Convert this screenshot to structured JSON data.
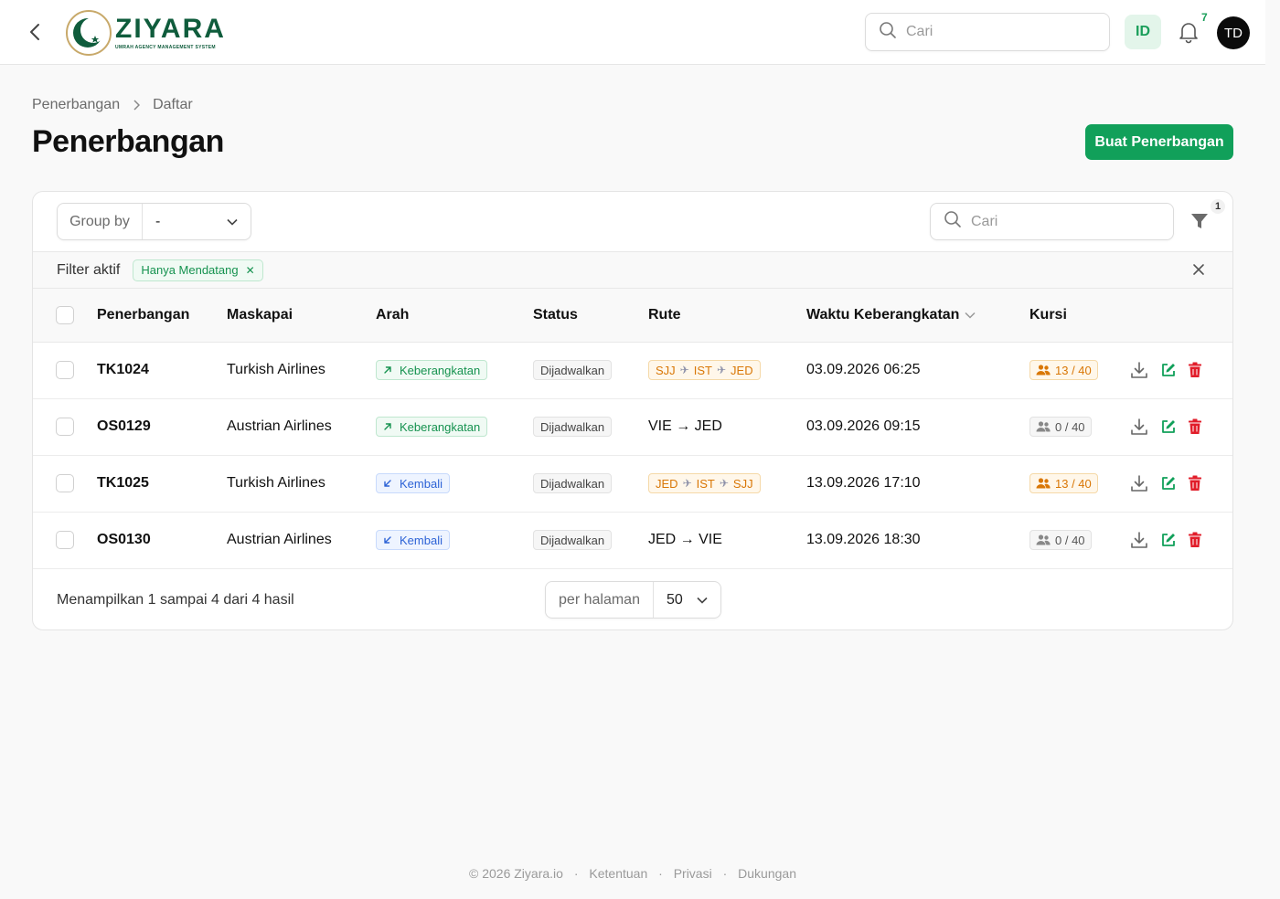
{
  "topbar": {
    "logo_name": "ZIYARA",
    "logo_sub": "UMRAH AGENCY MANAGEMENT SYSTEM",
    "search_placeholder": "Cari",
    "lang": "ID",
    "notification_count": "7",
    "avatar_initials": "TD"
  },
  "breadcrumb": {
    "parent": "Penerbangan",
    "current": "Daftar"
  },
  "page": {
    "title": "Penerbangan",
    "create_button": "Buat Penerbangan"
  },
  "toolbar": {
    "group_by_label": "Group by",
    "group_by_value": "-",
    "search_placeholder": "Cari",
    "filter_count": "1"
  },
  "filters": {
    "label": "Filter aktif",
    "chips": [
      "Hanya Mendatang"
    ]
  },
  "table": {
    "headers": {
      "flight": "Penerbangan",
      "airline": "Maskapai",
      "direction": "Arah",
      "status": "Status",
      "route": "Rute",
      "departure": "Waktu Keberangkatan",
      "seats": "Kursi"
    },
    "rows": [
      {
        "flight": "TK1024",
        "airline": "Turkish Airlines",
        "direction": "Keberangkatan",
        "direction_type": "departure",
        "status": "Dijadwalkan",
        "route_type": "multi",
        "route": [
          "SJJ",
          "IST",
          "JED"
        ],
        "route_text": "",
        "departure": "03.09.2026 06:25",
        "seats": "13 / 40",
        "seats_type": "full"
      },
      {
        "flight": "OS0129",
        "airline": "Austrian Airlines",
        "direction": "Keberangkatan",
        "direction_type": "departure",
        "status": "Dijadwalkan",
        "route_type": "simple",
        "route": [],
        "route_text": "VIE → JED",
        "departure": "03.09.2026 09:15",
        "seats": "0 / 40",
        "seats_type": "empty"
      },
      {
        "flight": "TK1025",
        "airline": "Turkish Airlines",
        "direction": "Kembali",
        "direction_type": "return",
        "status": "Dijadwalkan",
        "route_type": "multi",
        "route": [
          "JED",
          "IST",
          "SJJ"
        ],
        "route_text": "",
        "departure": "13.09.2026 17:10",
        "seats": "13 / 40",
        "seats_type": "full"
      },
      {
        "flight": "OS0130",
        "airline": "Austrian Airlines",
        "direction": "Kembali",
        "direction_type": "return",
        "status": "Dijadwalkan",
        "route_type": "simple",
        "route": [],
        "route_text": "JED → VIE",
        "departure": "13.09.2026 18:30",
        "seats": "0 / 40",
        "seats_type": "empty"
      }
    ]
  },
  "pagination": {
    "result_text": "Menampilkan 1 sampai 4 dari 4 hasil",
    "per_page_label": "per halaman",
    "per_page_value": "50"
  },
  "footer": {
    "copyright": "© 2026 Ziyara.io",
    "links": [
      "Ketentuan",
      "Privasi",
      "Dukungan"
    ]
  },
  "colors": {
    "accent": "#11a05a",
    "brand": "#0f5c3c",
    "warning": "#d97706",
    "info": "#2d63d6",
    "danger": "#e11d2a"
  }
}
